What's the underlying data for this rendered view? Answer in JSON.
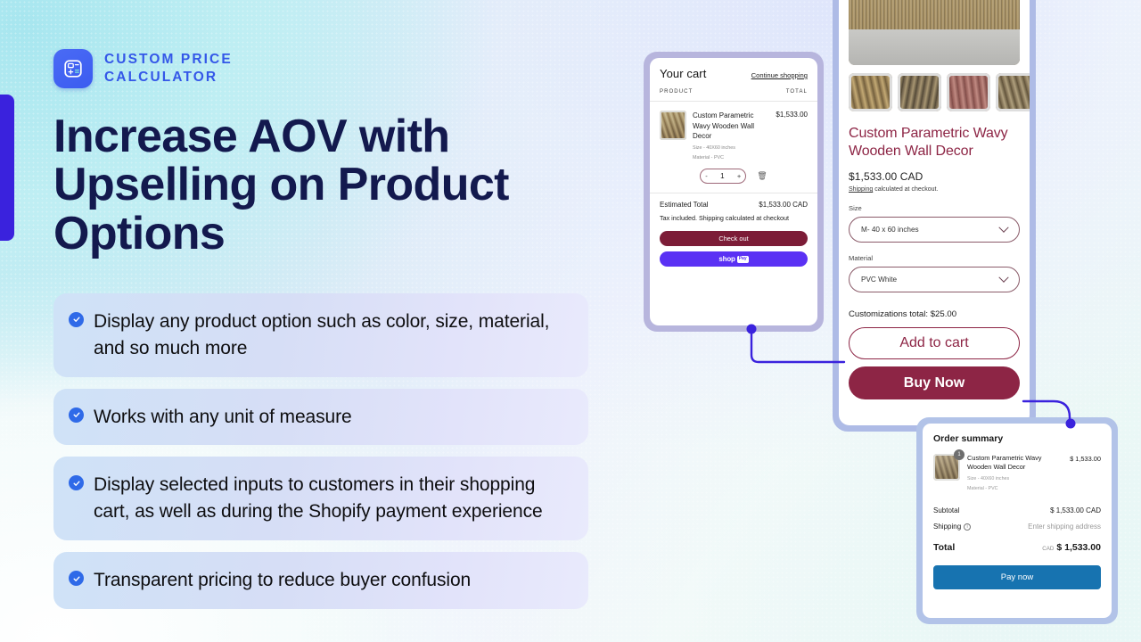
{
  "brand": {
    "line1": "Custom Price",
    "line2": "Calculator",
    "logo_icon": "calculator-icon",
    "accent_color": "#3457e8"
  },
  "headline": "Increase AOV with Upselling on Product Options",
  "accent_bar_color": "#3a22dd",
  "features": [
    {
      "icon": "check-circle-icon",
      "text": "Display any product option such as color, size, material, and so much more"
    },
    {
      "icon": "check-circle-icon",
      "text": "Works with any unit of measure"
    },
    {
      "icon": "check-circle-icon",
      "text": "Display selected inputs to customers in their shopping cart, as well as during the Shopify payment experience"
    },
    {
      "icon": "check-circle-icon",
      "text": "Transparent pricing to reduce buyer confusion"
    }
  ],
  "cart": {
    "title": "Your cart",
    "continue_link": "Continue shopping",
    "col_product": "PRODUCT",
    "col_total": "TOTAL",
    "item": {
      "name": "Custom Parametric Wavy Wooden Wall Decor",
      "option_size": "Size - 40X60 inches",
      "option_material": "Material - PVC",
      "price": "$1,533.00"
    },
    "qty_minus": "-",
    "qty_value": "1",
    "qty_plus": "+",
    "remove_icon": "trash-icon",
    "estimated_total_label": "Estimated Total",
    "estimated_total_value": "$1,533.00 CAD",
    "tax_note": "Tax included. Shipping calculated at checkout",
    "checkout_button": "Check out",
    "shoppay_word": "shop",
    "shoppay_tag": "Pay"
  },
  "product": {
    "title": "Custom Parametric Wavy Wooden Wall Decor",
    "price": "$1,533.00 CAD",
    "shipping_link": "Shipping",
    "shipping_note": " calculated at checkout.",
    "size_label": "Size",
    "size_value": "M- 40 x 60 inches",
    "material_label": "Material",
    "material_value": "PVC White",
    "customizations_total": "Customizations total: $25.00",
    "add_to_cart": "Add to cart",
    "buy_now": "Buy Now",
    "brand_color": "#8d2545"
  },
  "order_summary": {
    "title": "Order summary",
    "item": {
      "badge": "1",
      "name": "Custom Parametric Wavy Wooden Wall Decor",
      "option_size": "Size - 40X60 inches",
      "option_material": "Material - PVC",
      "price": "$ 1,533.00"
    },
    "subtotal_label": "Subtotal",
    "subtotal_value": "$ 1,533.00 CAD",
    "shipping_label": "Shipping",
    "shipping_value": "Enter shipping address",
    "total_label": "Total",
    "total_currency": "CAD",
    "total_value": "$ 1,533.00",
    "pay_now": "Pay now",
    "pay_color": "#1773b0"
  },
  "connector_color": "#3a22dd"
}
